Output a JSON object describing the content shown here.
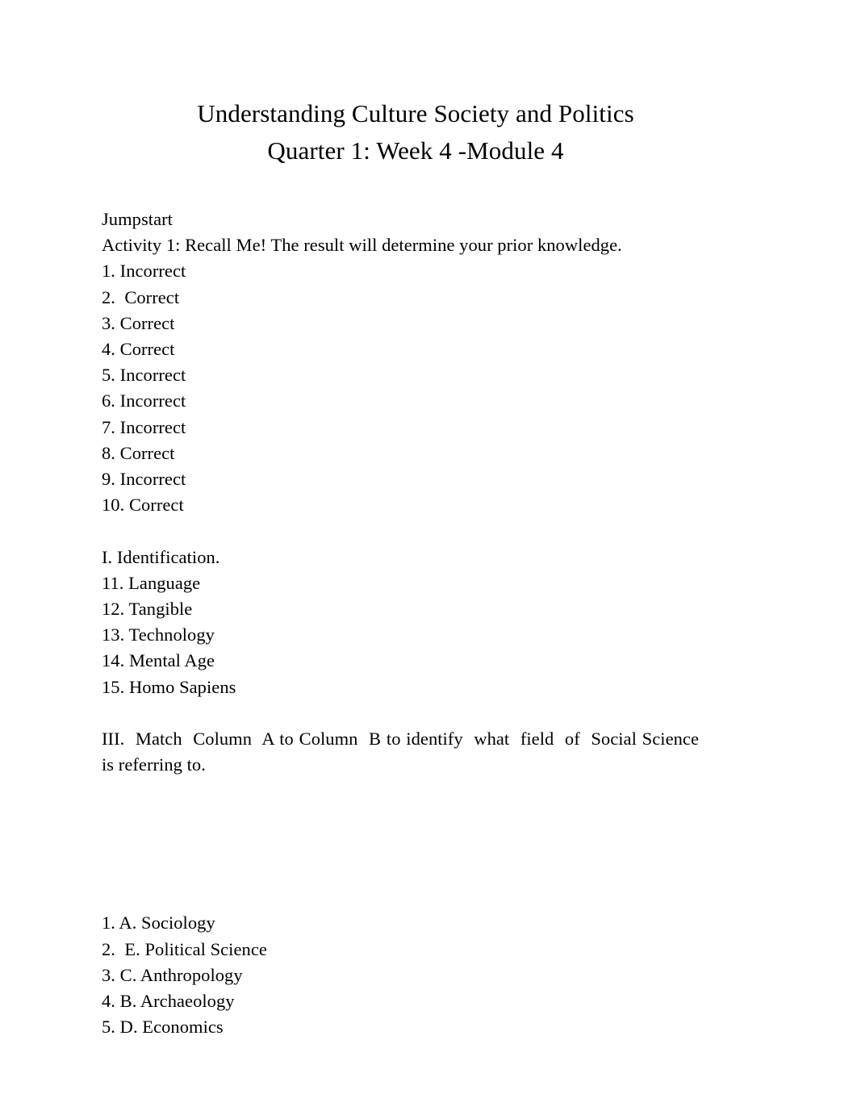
{
  "document": {
    "title_lines": [
      "Understanding Culture Society and Politics",
      "Quarter 1: Week 4 -Module 4"
    ],
    "section_jumpstart": {
      "heading": "Jumpstart",
      "activity_line": "Activity 1: Recall Me! The result will determine your prior knowledge.",
      "answers": [
        "1. Incorrect",
        "2.  Correct",
        "3. Correct",
        "4. Correct",
        "5. Incorrect",
        "6. Incorrect",
        "7. Incorrect",
        "8. Correct",
        "9. Incorrect",
        "10. Correct"
      ]
    },
    "section_identification": {
      "heading": "I. Identification.",
      "answers": [
        "11. Language",
        "12. Tangible",
        "13. Technology",
        "14. Mental Age",
        "15. Homo Sapiens"
      ]
    },
    "section_matching": {
      "instruction": "III.  Match  Column  A to Column  B to identify  what  field  of  Social Science  is referring to.",
      "answers": [
        "1. A. Sociology",
        "2.  E. Political Science",
        "3. C. Anthropology",
        "4. B. Archaeology",
        "5. D. Economics"
      ]
    }
  },
  "colors": {
    "page_background": "#ffffff",
    "text": "#000000"
  }
}
